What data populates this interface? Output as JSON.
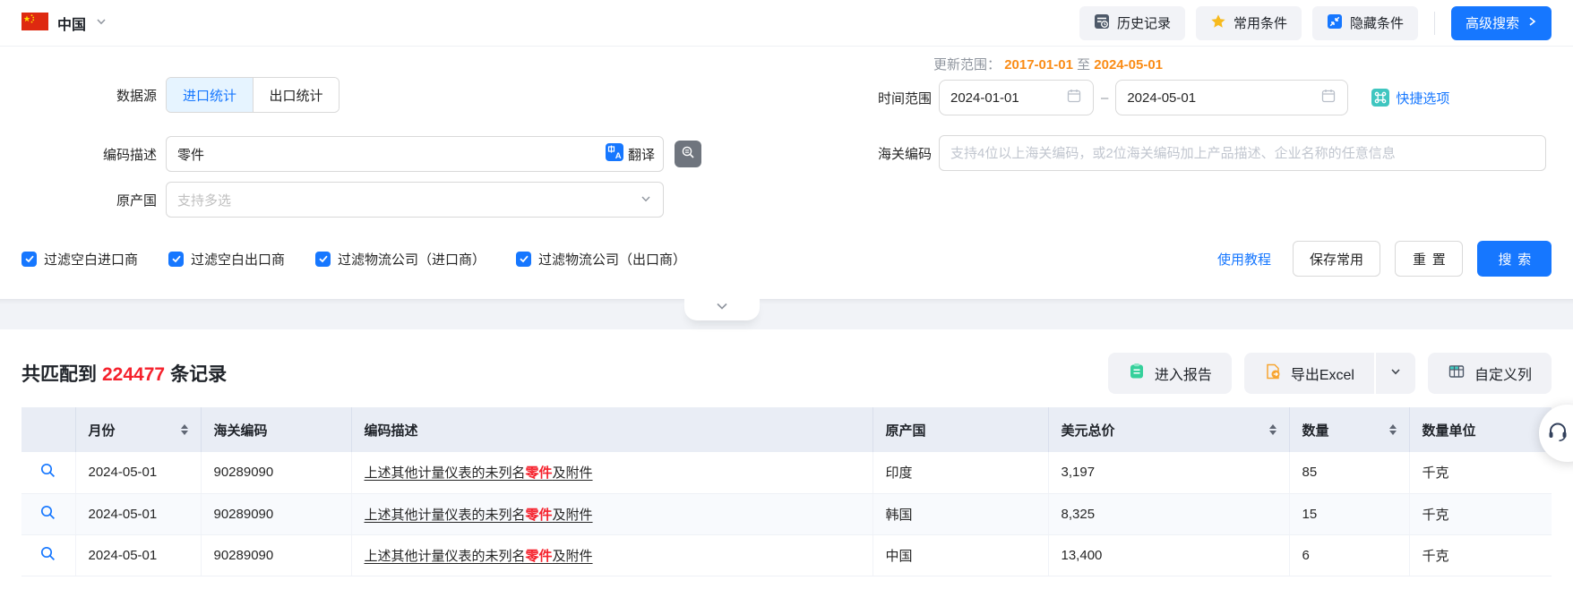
{
  "topbar": {
    "country": "中国",
    "history": "历史记录",
    "favorites": "常用条件",
    "hide": "隐藏条件",
    "advanced": "高级搜索"
  },
  "form": {
    "datasource_label": "数据源",
    "tab_import": "进口统计",
    "tab_export": "出口统计",
    "codedesc_label": "编码描述",
    "codedesc_value": "零件",
    "translate": "翻译",
    "origin_label": "原产国",
    "origin_placeholder": "支持多选",
    "update_label": "更新范围：",
    "update_from": "2017-01-01",
    "update_to_word": "至",
    "update_to": "2024-05-01",
    "time_label": "时间范围",
    "time_start": "2024-01-01",
    "time_separator": "–",
    "time_end": "2024-05-01",
    "quick_options": "快捷选项",
    "hscode_label": "海关编码",
    "hscode_placeholder": "支持4位以上海关编码，或2位海关编码加上产品描述、企业名称的任意信息",
    "checkbox1": "过滤空白进口商",
    "checkbox2": "过滤空白出口商",
    "checkbox3": "过滤物流公司（进口商）",
    "checkbox4": "过滤物流公司（出口商）",
    "tutorial": "使用教程",
    "save_common": "保存常用",
    "reset": "重置",
    "search": "搜索"
  },
  "results": {
    "match_prefix": "共匹配到",
    "match_count": "224477",
    "match_suffix": "条记录",
    "enter_report": "进入报告",
    "export_excel": "导出Excel",
    "custom_columns": "自定义列"
  },
  "table": {
    "col_month": "月份",
    "col_hscode": "海关编码",
    "col_desc": "编码描述",
    "col_origin": "原产国",
    "col_usd": "美元总价",
    "col_qty": "数量",
    "col_unit": "数量单位",
    "rows": [
      {
        "month": "2024-05-01",
        "hscode": "90289090",
        "desc_pre": "上述其他计量仪表的未列名",
        "desc_highlight": "零件",
        "desc_post": "及附件",
        "origin": "印度",
        "usd": "3,197",
        "qty": "85",
        "unit": "千克"
      },
      {
        "month": "2024-05-01",
        "hscode": "90289090",
        "desc_pre": "上述其他计量仪表的未列名",
        "desc_highlight": "零件",
        "desc_post": "及附件",
        "origin": "韩国",
        "usd": "8,325",
        "qty": "15",
        "unit": "千克"
      },
      {
        "month": "2024-05-01",
        "hscode": "90289090",
        "desc_pre": "上述其他计量仪表的未列名",
        "desc_highlight": "零件",
        "desc_post": "及附件",
        "origin": "中国",
        "usd": "13,400",
        "qty": "6",
        "unit": "千克"
      }
    ]
  },
  "colors": {
    "primary": "#1677ff",
    "accent_orange": "#fa8c16",
    "accent_red": "#f5222d"
  }
}
